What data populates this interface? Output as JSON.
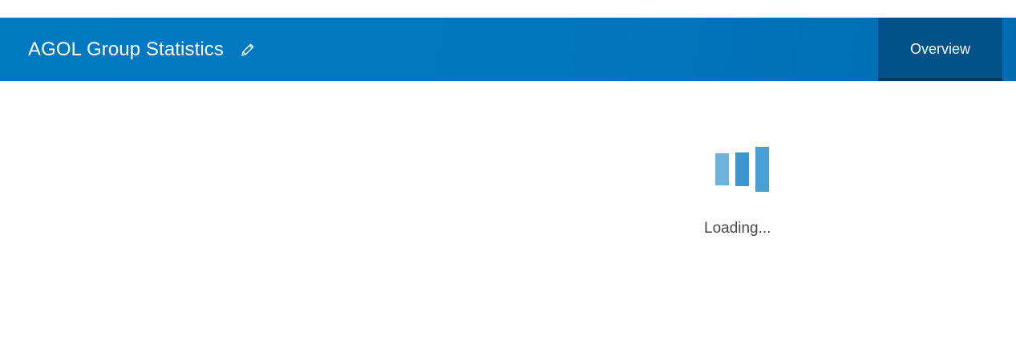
{
  "header": {
    "title": "AGOL Group Statistics",
    "edit_icon": "pencil-icon",
    "nav": {
      "tabs": [
        {
          "label": "Overview",
          "active": true
        }
      ]
    }
  },
  "main": {
    "loader": {
      "icon": "loading-bars-icon",
      "text": "Loading..."
    }
  },
  "colors": {
    "header_bg": "#0179c1",
    "active_tab_bg": "#005289",
    "loader_bar_light": "#6fb3dc",
    "loader_bar_mid": "#3b95cf",
    "loader_bar_dark": "#4a9fd5",
    "text_muted": "#4a4a4a"
  }
}
